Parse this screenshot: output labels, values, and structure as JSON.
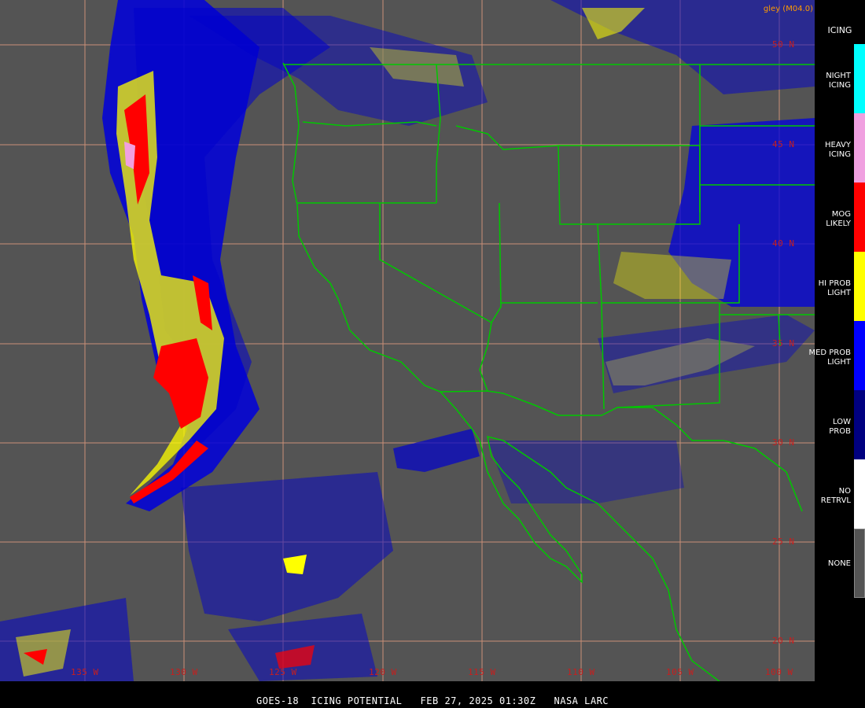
{
  "credit": "gley (M04.0)",
  "caption": "GOES-18  ICING POTENTIAL   FEB 27, 2025 01:30Z   NASA LARC",
  "grid": {
    "lat_labels": [
      "50 N",
      "45 N",
      "40 N",
      "35 N",
      "30 N",
      "25 N",
      "20 N"
    ],
    "lon_labels": [
      "135 W",
      "130 W",
      "125 W",
      "120 W",
      "115 W",
      "110 W",
      "105 W",
      "100 W"
    ]
  },
  "legend": {
    "title": "ICING",
    "items": [
      {
        "label": "NIGHT\nICING",
        "color": "#00ffff"
      },
      {
        "label": "HEAVY\nICING",
        "color": "#f0a0e0"
      },
      {
        "label": "MOG\nLIKELY",
        "color": "#ff0000"
      },
      {
        "label": "HI PROB\nLIGHT",
        "color": "#ffff00"
      },
      {
        "label": "MED PROB\nLIGHT",
        "color": "#0000ff"
      },
      {
        "label": "LOW\nPROB",
        "color": "#000080"
      },
      {
        "label": "NO\nRETRVL",
        "color": "#ffffff"
      },
      {
        "label": "NONE",
        "color": "#545454"
      }
    ]
  },
  "colors": {
    "background": "#545454",
    "gridline": "#e8a080",
    "boundary": "#00c800",
    "label": "#c81e1e"
  }
}
